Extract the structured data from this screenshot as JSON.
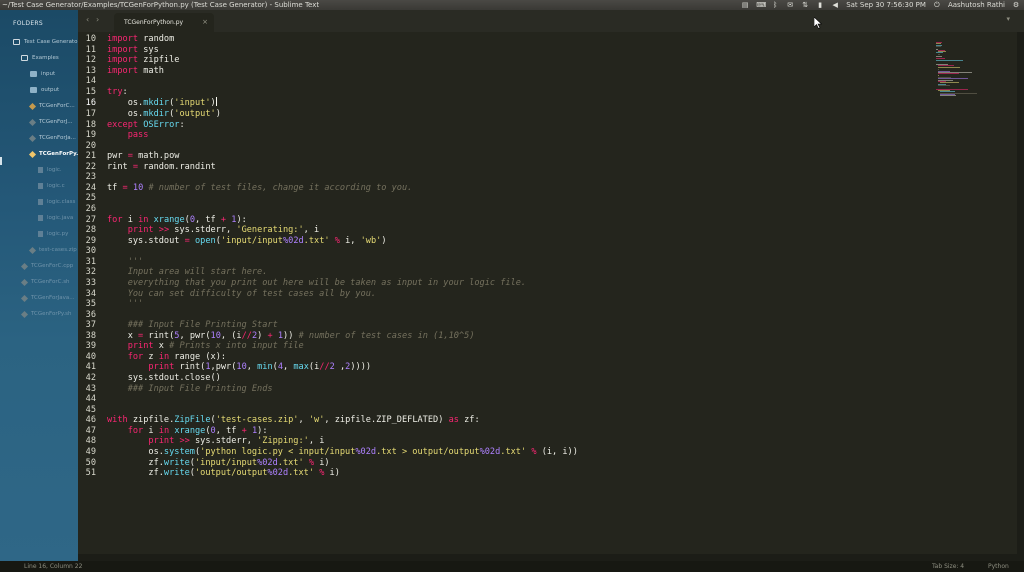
{
  "window": {
    "title": "~/Test Case Generator/Examples/TCGenForPython.py (Test Case Generator) - Sublime Text",
    "clock": "Sat Sep 30  7:56:30 PM",
    "user": "Aashutosh Rathi"
  },
  "sidebar": {
    "heading": "FOLDERS",
    "items": [
      {
        "label": "Test Case Generator",
        "icon": "folder-open-icon"
      },
      {
        "label": "Examples",
        "icon": "folder-open-icon"
      },
      {
        "label": "input",
        "icon": "folder-icon"
      },
      {
        "label": "output",
        "icon": "folder-icon"
      },
      {
        "label": "TCGenForC...",
        "icon": "file-icon"
      },
      {
        "label": "TCGenForJ...",
        "icon": "file-icon"
      },
      {
        "label": "TCGenForJa...",
        "icon": "file-icon"
      },
      {
        "label": "TCGenForPy...",
        "icon": "file-icon"
      },
      {
        "label": "logic.",
        "icon": "file-icon"
      },
      {
        "label": "logic.c",
        "icon": "file-icon"
      },
      {
        "label": "logic.class",
        "icon": "file-icon"
      },
      {
        "label": "logic.java",
        "icon": "file-icon"
      },
      {
        "label": "logic.py",
        "icon": "file-icon"
      },
      {
        "label": "test-cases.zip",
        "icon": "file-icon"
      },
      {
        "label": "TCGenForC.cpp",
        "icon": "file-icon"
      },
      {
        "label": "TCGenForC.sh",
        "icon": "file-icon"
      },
      {
        "label": "TCGenForJava...",
        "icon": "file-icon"
      },
      {
        "label": "TCGenForPy.sh",
        "icon": "file-icon"
      }
    ]
  },
  "tabs": [
    {
      "label": "TCGenForPython.py",
      "active": true,
      "close": "×"
    }
  ],
  "nav": {
    "back": "‹",
    "forward": "›",
    "dropdown": "▾"
  },
  "editor": {
    "language": "python",
    "current_line": 16,
    "lines": [
      {
        "n": 10,
        "code": "import random"
      },
      {
        "n": 11,
        "code": "import sys"
      },
      {
        "n": 12,
        "code": "import zipfile"
      },
      {
        "n": 13,
        "code": "import math"
      },
      {
        "n": 14,
        "code": ""
      },
      {
        "n": 15,
        "code": "try:"
      },
      {
        "n": 16,
        "code": "    os.mkdir('input')"
      },
      {
        "n": 17,
        "code": "    os.mkdir('output')"
      },
      {
        "n": 18,
        "code": "except OSError:"
      },
      {
        "n": 19,
        "code": "    pass"
      },
      {
        "n": 20,
        "code": ""
      },
      {
        "n": 21,
        "code": "pwr = math.pow"
      },
      {
        "n": 22,
        "code": "rint = random.randint"
      },
      {
        "n": 23,
        "code": ""
      },
      {
        "n": 24,
        "code": "tf = 10 # number of test files, change it according to you."
      },
      {
        "n": 25,
        "code": ""
      },
      {
        "n": 26,
        "code": ""
      },
      {
        "n": 27,
        "code": "for i in xrange(0, tf + 1):"
      },
      {
        "n": 28,
        "code": "    print >> sys.stderr, 'Generating:', i"
      },
      {
        "n": 29,
        "code": "    sys.stdout = open('input/input%02d.txt' % i, 'wb')"
      },
      {
        "n": 30,
        "code": ""
      },
      {
        "n": 31,
        "code": "    '''"
      },
      {
        "n": 32,
        "code": "    Input area will start here."
      },
      {
        "n": 33,
        "code": "    everything that you print out here will be taken as input in your logic file."
      },
      {
        "n": 34,
        "code": "    You can set difficulty of test cases all by you."
      },
      {
        "n": 35,
        "code": "    '''"
      },
      {
        "n": 36,
        "code": ""
      },
      {
        "n": 37,
        "code": "    ### Input File Printing Start"
      },
      {
        "n": 38,
        "code": "    x = rint(5, pwr(10, (i//2) + 1)) # number of test cases in (1,10^5)"
      },
      {
        "n": 39,
        "code": "    print x # Prints x into input file"
      },
      {
        "n": 40,
        "code": "    for z in range (x):"
      },
      {
        "n": 41,
        "code": "        print rint(1,pwr(10, min(4, max(i//2 ,2))))"
      },
      {
        "n": 42,
        "code": "    sys.stdout.close()"
      },
      {
        "n": 43,
        "code": "    ### Input File Printing Ends"
      },
      {
        "n": 44,
        "code": ""
      },
      {
        "n": 45,
        "code": ""
      },
      {
        "n": 46,
        "code": "with zipfile.ZipFile('test-cases.zip', 'w', zipfile.ZIP_DEFLATED) as zf:"
      },
      {
        "n": 47,
        "code": "    for i in xrange(0, tf + 1):"
      },
      {
        "n": 48,
        "code": "        print >> sys.stderr, 'Zipping:', i"
      },
      {
        "n": 49,
        "code": "        os.system('python logic.py < input/input%02d.txt > output/output%02d.txt' % (i, i))"
      },
      {
        "n": 50,
        "code": "        zf.write('input/input%02d.txt' % i)"
      },
      {
        "n": 51,
        "code": "        zf.write('output/output%02d.txt' % i)"
      }
    ]
  },
  "statusbar": {
    "position": "Line 16, Column 22",
    "tab_size": "Tab Size: 4",
    "syntax": "Python"
  },
  "colors": {
    "editor_bg": "#24251d",
    "sidebar_bg": "#245878",
    "keyword": "#f92672",
    "function": "#66d9ef",
    "string": "#e6db74",
    "number": "#ae81ff",
    "comment": "#75715e"
  }
}
